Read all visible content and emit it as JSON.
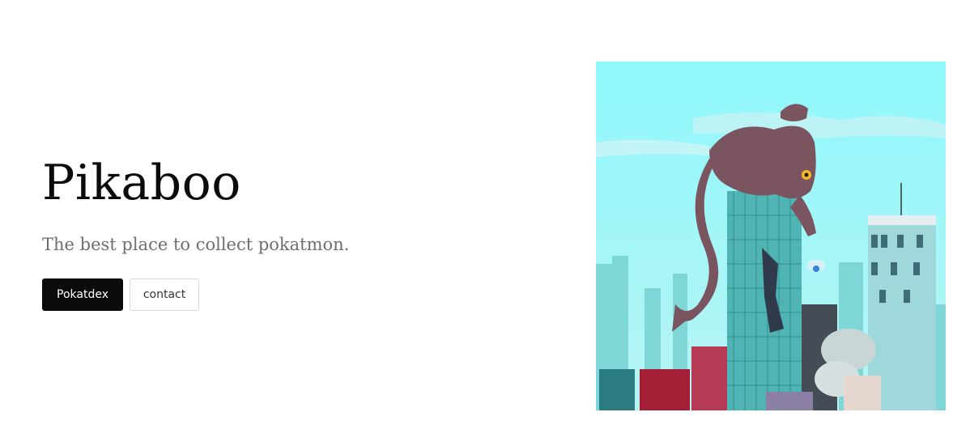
{
  "hero": {
    "title": "Pikaboo",
    "subtitle": "The best place to collect pokatmon.",
    "primary_button": "Pokatdex",
    "secondary_button": "contact"
  },
  "image": {
    "subject": "giant cat monster on skyscraper illustration"
  },
  "colors": {
    "title": "#0b0b0b",
    "subtitle": "#6e6e6e",
    "primary_button_bg": "#0b0b0b",
    "sky": "#8ef8fb",
    "building_teal": "#4fb4b3"
  }
}
